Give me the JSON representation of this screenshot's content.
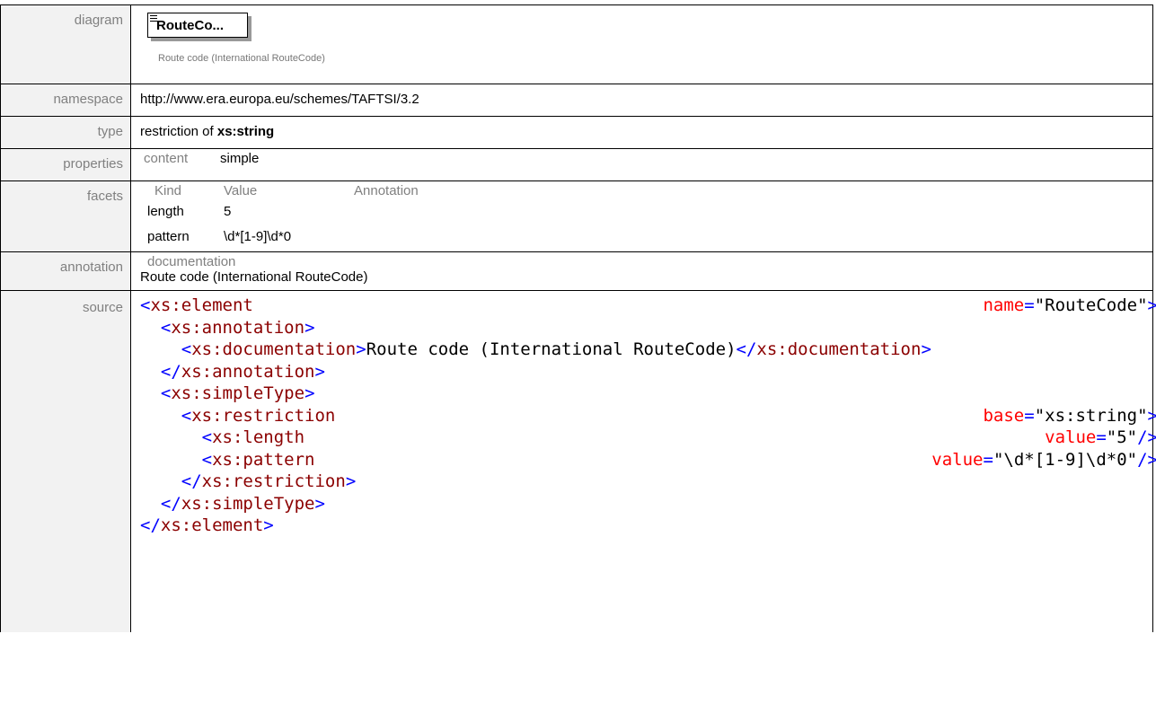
{
  "rows": {
    "diagram": {
      "label": "diagram",
      "node_name": "RouteCo...",
      "node_doc": "Route code (International RouteCode)"
    },
    "namespace": {
      "label": "namespace",
      "value": "http://www.era.europa.eu/schemes/TAFTSI/3.2"
    },
    "type": {
      "label": "type",
      "prefix": "restriction of ",
      "base": "xs:string"
    },
    "properties": {
      "label": "properties",
      "key": "content",
      "value": "simple"
    },
    "facets": {
      "label": "facets",
      "headers": [
        "Kind",
        "Value",
        "Annotation"
      ],
      "rows": [
        {
          "kind": "length",
          "value": "5"
        },
        {
          "kind": "pattern",
          "value": "\\d*[1-9]\\d*0"
        }
      ]
    },
    "annotation": {
      "label": "annotation",
      "heading": "documentation",
      "text": "Route code (International RouteCode)"
    },
    "source": {
      "label": "source",
      "lines": [
        {
          "indent": "",
          "open": "<",
          "tag": "xs:element",
          "attr": "name",
          "value": "\"RouteCode\"",
          "close": ">"
        },
        {
          "indent": "  ",
          "open": "<",
          "tag": "xs:annotation",
          "close": ">"
        },
        {
          "indent": "    ",
          "open": "<",
          "tag": "xs:documentation",
          "mid": ">",
          "text": "Route code (International RouteCode)",
          "open2": "</",
          "tag2": "xs:documentation",
          "close": ">"
        },
        {
          "indent": "  ",
          "open": "</",
          "tag": "xs:annotation",
          "close": ">"
        },
        {
          "indent": "  ",
          "open": "<",
          "tag": "xs:simpleType",
          "close": ">"
        },
        {
          "indent": "    ",
          "open": "<",
          "tag": "xs:restriction",
          "attr": "base",
          "value": "\"xs:string\"",
          "close": ">"
        },
        {
          "indent": "      ",
          "open": "<",
          "tag": "xs:length",
          "attr": "value",
          "value": "\"5\"",
          "close": "/>"
        },
        {
          "indent": "      ",
          "open": "<",
          "tag": "xs:pattern",
          "attr": "value",
          "value": "\"\\d*[1-9]\\d*0\"",
          "close": "/>"
        },
        {
          "indent": "    ",
          "open": "</",
          "tag": "xs:restriction",
          "close": ">"
        },
        {
          "indent": "  ",
          "open": "</",
          "tag": "xs:simpleType",
          "close": ">"
        },
        {
          "indent": "",
          "open": "</",
          "tag": "xs:element",
          "close": ">"
        }
      ]
    }
  }
}
